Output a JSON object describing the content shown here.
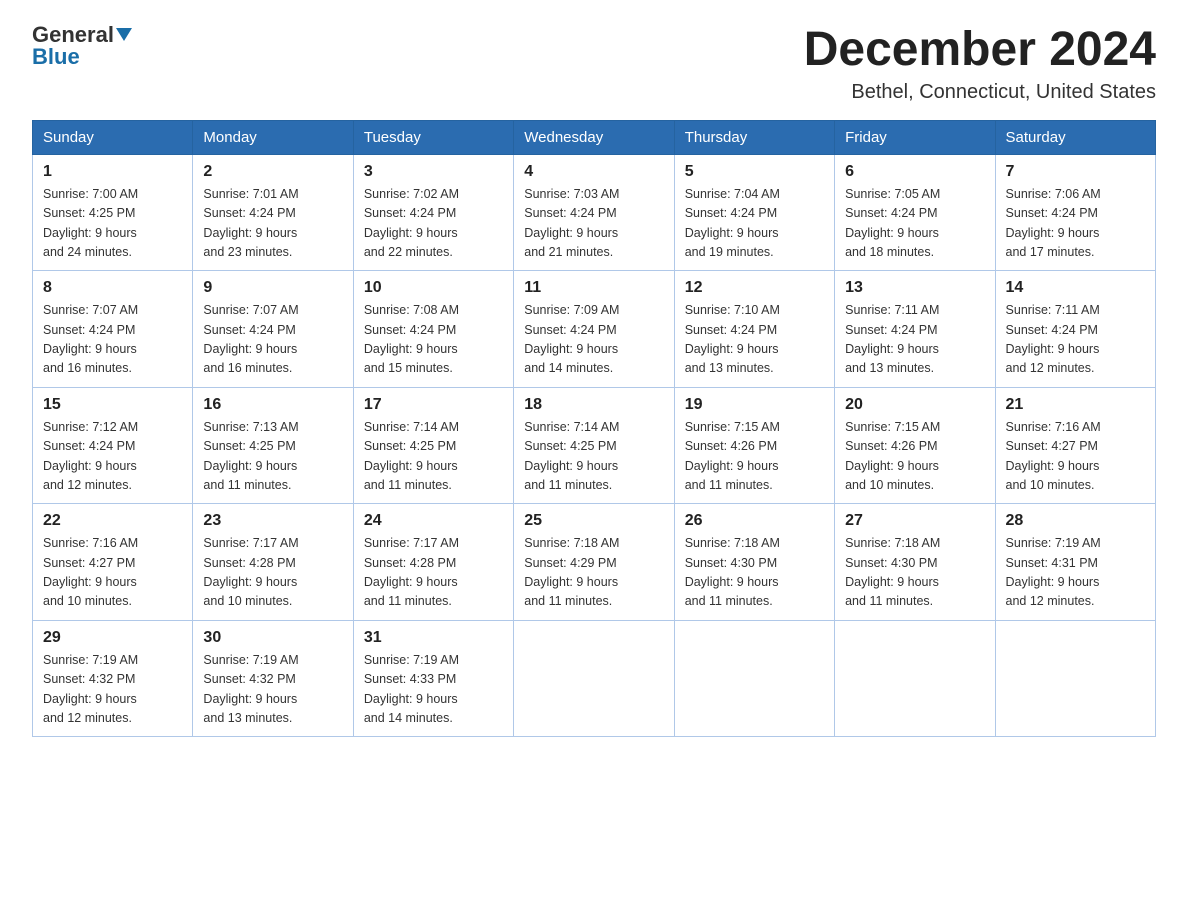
{
  "header": {
    "logo_general": "General",
    "logo_blue": "Blue",
    "month_title": "December 2024",
    "location": "Bethel, Connecticut, United States"
  },
  "weekdays": [
    "Sunday",
    "Monday",
    "Tuesday",
    "Wednesday",
    "Thursday",
    "Friday",
    "Saturday"
  ],
  "weeks": [
    [
      {
        "day": "1",
        "sunrise": "7:00 AM",
        "sunset": "4:25 PM",
        "daylight": "9 hours and 24 minutes."
      },
      {
        "day": "2",
        "sunrise": "7:01 AM",
        "sunset": "4:24 PM",
        "daylight": "9 hours and 23 minutes."
      },
      {
        "day": "3",
        "sunrise": "7:02 AM",
        "sunset": "4:24 PM",
        "daylight": "9 hours and 22 minutes."
      },
      {
        "day": "4",
        "sunrise": "7:03 AM",
        "sunset": "4:24 PM",
        "daylight": "9 hours and 21 minutes."
      },
      {
        "day": "5",
        "sunrise": "7:04 AM",
        "sunset": "4:24 PM",
        "daylight": "9 hours and 19 minutes."
      },
      {
        "day": "6",
        "sunrise": "7:05 AM",
        "sunset": "4:24 PM",
        "daylight": "9 hours and 18 minutes."
      },
      {
        "day": "7",
        "sunrise": "7:06 AM",
        "sunset": "4:24 PM",
        "daylight": "9 hours and 17 minutes."
      }
    ],
    [
      {
        "day": "8",
        "sunrise": "7:07 AM",
        "sunset": "4:24 PM",
        "daylight": "9 hours and 16 minutes."
      },
      {
        "day": "9",
        "sunrise": "7:07 AM",
        "sunset": "4:24 PM",
        "daylight": "9 hours and 16 minutes."
      },
      {
        "day": "10",
        "sunrise": "7:08 AM",
        "sunset": "4:24 PM",
        "daylight": "9 hours and 15 minutes."
      },
      {
        "day": "11",
        "sunrise": "7:09 AM",
        "sunset": "4:24 PM",
        "daylight": "9 hours and 14 minutes."
      },
      {
        "day": "12",
        "sunrise": "7:10 AM",
        "sunset": "4:24 PM",
        "daylight": "9 hours and 13 minutes."
      },
      {
        "day": "13",
        "sunrise": "7:11 AM",
        "sunset": "4:24 PM",
        "daylight": "9 hours and 13 minutes."
      },
      {
        "day": "14",
        "sunrise": "7:11 AM",
        "sunset": "4:24 PM",
        "daylight": "9 hours and 12 minutes."
      }
    ],
    [
      {
        "day": "15",
        "sunrise": "7:12 AM",
        "sunset": "4:24 PM",
        "daylight": "9 hours and 12 minutes."
      },
      {
        "day": "16",
        "sunrise": "7:13 AM",
        "sunset": "4:25 PM",
        "daylight": "9 hours and 11 minutes."
      },
      {
        "day": "17",
        "sunrise": "7:14 AM",
        "sunset": "4:25 PM",
        "daylight": "9 hours and 11 minutes."
      },
      {
        "day": "18",
        "sunrise": "7:14 AM",
        "sunset": "4:25 PM",
        "daylight": "9 hours and 11 minutes."
      },
      {
        "day": "19",
        "sunrise": "7:15 AM",
        "sunset": "4:26 PM",
        "daylight": "9 hours and 11 minutes."
      },
      {
        "day": "20",
        "sunrise": "7:15 AM",
        "sunset": "4:26 PM",
        "daylight": "9 hours and 10 minutes."
      },
      {
        "day": "21",
        "sunrise": "7:16 AM",
        "sunset": "4:27 PM",
        "daylight": "9 hours and 10 minutes."
      }
    ],
    [
      {
        "day": "22",
        "sunrise": "7:16 AM",
        "sunset": "4:27 PM",
        "daylight": "9 hours and 10 minutes."
      },
      {
        "day": "23",
        "sunrise": "7:17 AM",
        "sunset": "4:28 PM",
        "daylight": "9 hours and 10 minutes."
      },
      {
        "day": "24",
        "sunrise": "7:17 AM",
        "sunset": "4:28 PM",
        "daylight": "9 hours and 11 minutes."
      },
      {
        "day": "25",
        "sunrise": "7:18 AM",
        "sunset": "4:29 PM",
        "daylight": "9 hours and 11 minutes."
      },
      {
        "day": "26",
        "sunrise": "7:18 AM",
        "sunset": "4:30 PM",
        "daylight": "9 hours and 11 minutes."
      },
      {
        "day": "27",
        "sunrise": "7:18 AM",
        "sunset": "4:30 PM",
        "daylight": "9 hours and 11 minutes."
      },
      {
        "day": "28",
        "sunrise": "7:19 AM",
        "sunset": "4:31 PM",
        "daylight": "9 hours and 12 minutes."
      }
    ],
    [
      {
        "day": "29",
        "sunrise": "7:19 AM",
        "sunset": "4:32 PM",
        "daylight": "9 hours and 12 minutes."
      },
      {
        "day": "30",
        "sunrise": "7:19 AM",
        "sunset": "4:32 PM",
        "daylight": "9 hours and 13 minutes."
      },
      {
        "day": "31",
        "sunrise": "7:19 AM",
        "sunset": "4:33 PM",
        "daylight": "9 hours and 14 minutes."
      },
      null,
      null,
      null,
      null
    ]
  ],
  "labels": {
    "sunrise": "Sunrise:",
    "sunset": "Sunset:",
    "daylight": "Daylight:"
  }
}
